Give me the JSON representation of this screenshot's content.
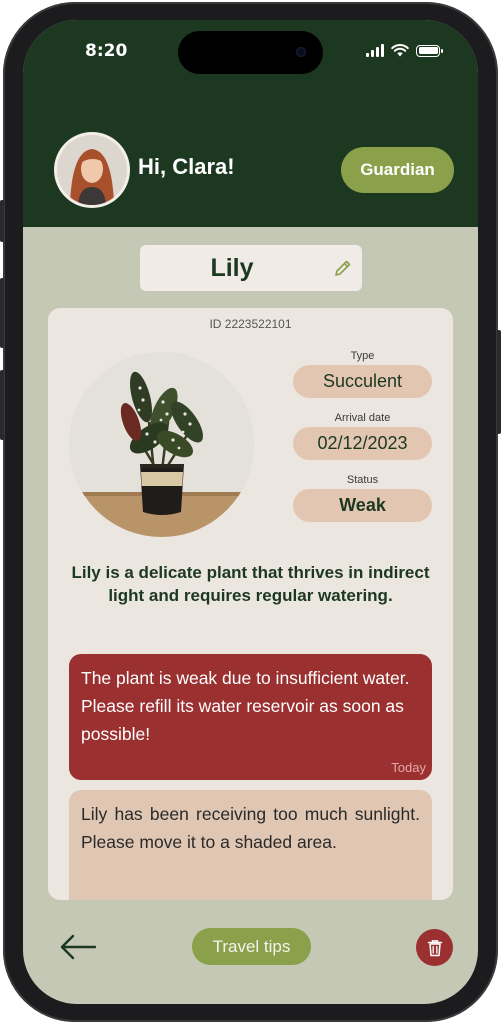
{
  "status_bar": {
    "time": "8:20",
    "icons": [
      "signal-icon",
      "wifi-icon",
      "battery-icon"
    ]
  },
  "header": {
    "greeting": "Hi, Clara!",
    "role_badge": "Guardian",
    "avatar_icon": "user-avatar"
  },
  "plant": {
    "name": "Lily",
    "edit_icon": "pencil-icon",
    "id_text": "ID 2223522101",
    "photo": "potted-plant-photo",
    "type_label": "Type",
    "type_value": "Succulent",
    "arrival_label": "Arrival date",
    "arrival_value": "02/12/2023",
    "status_label": "Status",
    "status_value": "Weak",
    "description": "Lily is a delicate plant that thrives in indirect light and requires regular watering."
  },
  "alerts": [
    {
      "text": "The plant is weak due to insufficient water. Please refill its water reservoir as soon as possible!",
      "time": "Today",
      "color": "#9b3030"
    },
    {
      "text": "Lily has been receiving too much sunlight. Please move it to a shaded area.",
      "color": "#e0c7b4"
    }
  ],
  "footer": {
    "back_icon": "arrow-left-icon",
    "tips_label": "Travel tips",
    "delete_icon": "trash-icon"
  },
  "colors": {
    "header_bg": "#1d3820",
    "screen_bg": "#c4c8b4",
    "accent_green": "#8aa04a",
    "alert_red": "#9b3030",
    "pill_tan": "#e2c6b2",
    "card_bg": "#ece6e1"
  }
}
